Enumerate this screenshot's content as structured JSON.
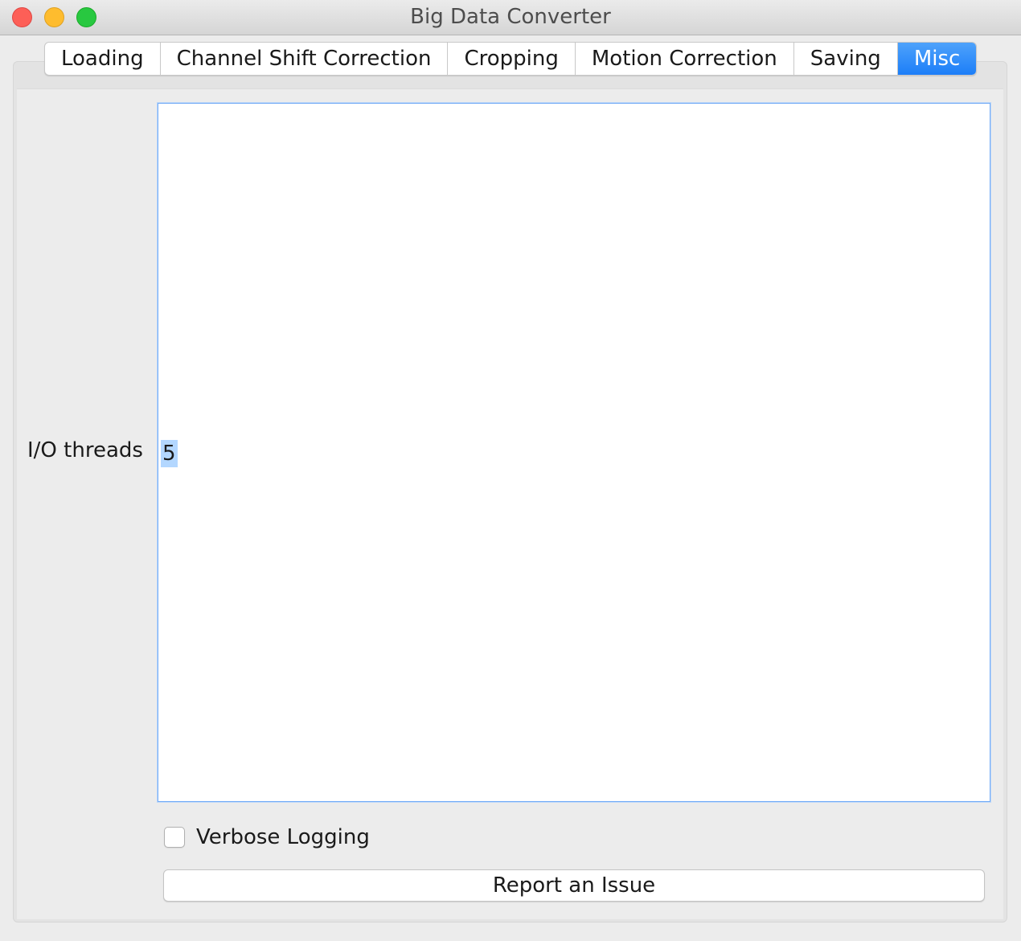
{
  "window": {
    "title": "Big Data Converter"
  },
  "tabs": [
    {
      "label": "Loading",
      "selected": false
    },
    {
      "label": "Channel Shift Correction",
      "selected": false
    },
    {
      "label": "Cropping",
      "selected": false
    },
    {
      "label": "Motion Correction",
      "selected": false
    },
    {
      "label": "Saving",
      "selected": false
    },
    {
      "label": "Misc",
      "selected": true
    }
  ],
  "misc": {
    "io_threads_label": "I/O threads",
    "io_threads_value": "5",
    "verbose_logging_label": "Verbose Logging",
    "verbose_logging_checked": false,
    "report_issue_label": "Report an Issue"
  },
  "colors": {
    "selected_tab": "#1c7ef8",
    "text_selection": "#b3d7ff",
    "focus_border": "#77aef6"
  }
}
